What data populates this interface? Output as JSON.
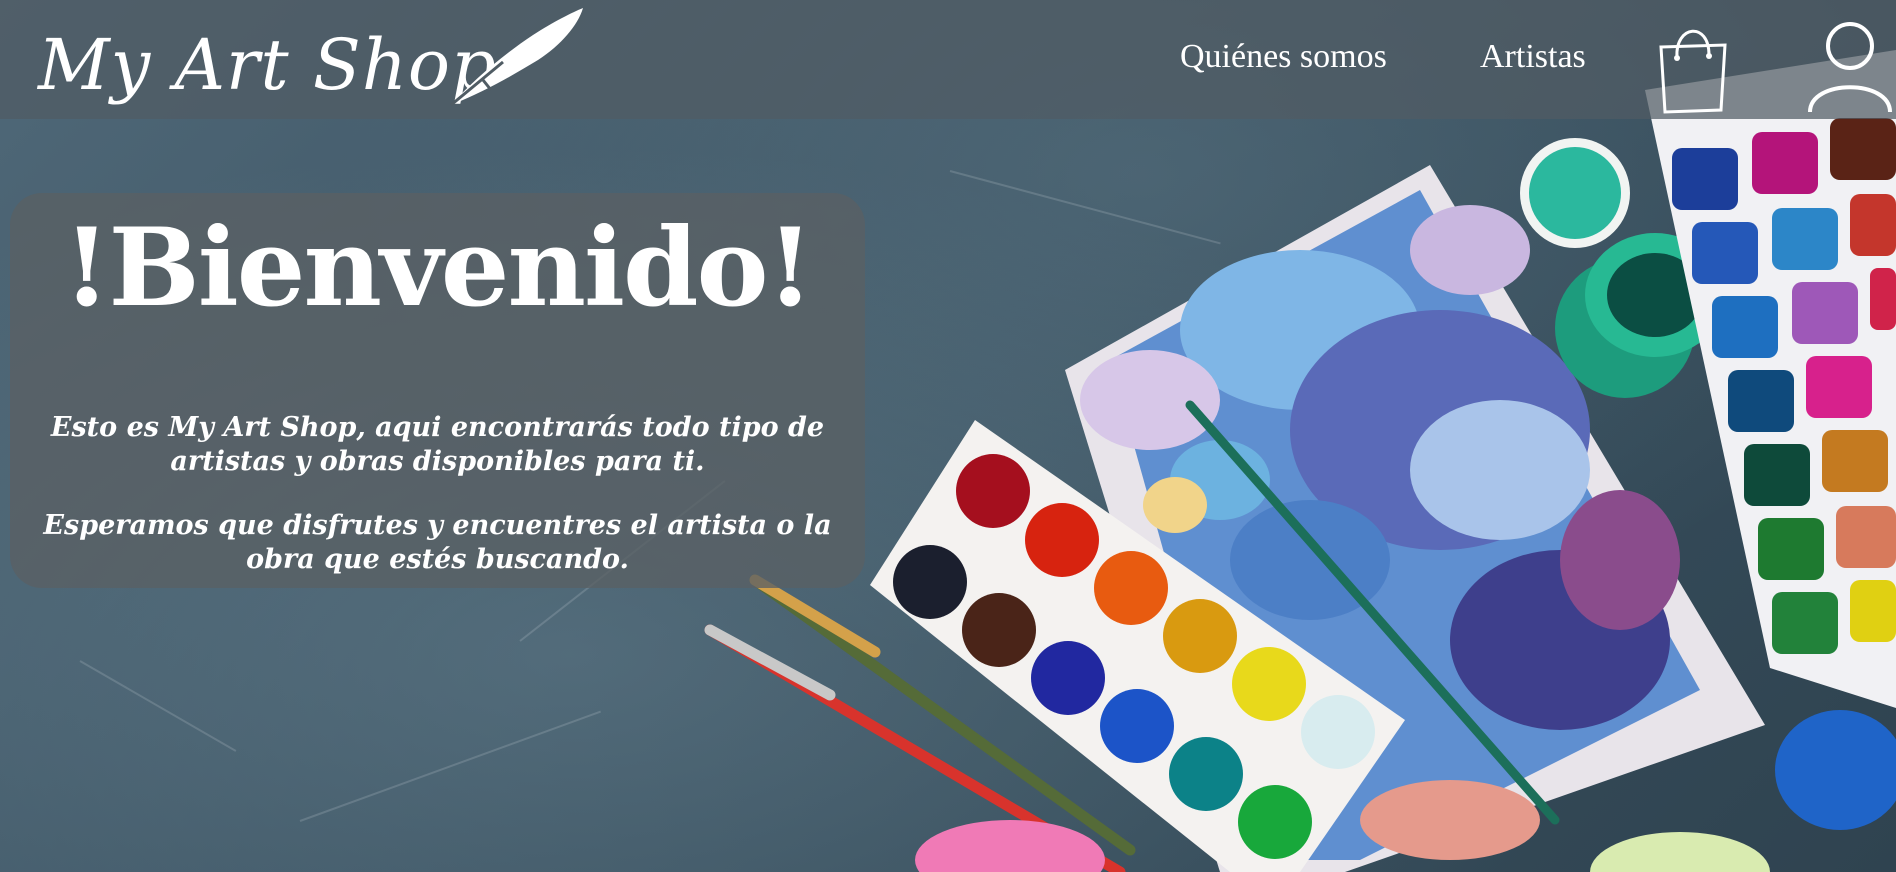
{
  "header": {
    "logo_text": "My Art Shop",
    "nav": [
      {
        "label": "Quiénes somos"
      },
      {
        "label": "Artistas"
      }
    ]
  },
  "welcome": {
    "title": "!Bienvenido!",
    "paragraph1": "Esto es My Art Shop, aqui encontrarás todo tipo de artistas y obras disponibles para ti.",
    "paragraph2": "Esperamos que disfrutes y encuentres el artista o la obra que estés buscando."
  },
  "icons": {
    "logo": "quill-pen-icon",
    "cart": "shopping-bag-icon",
    "account": "user-icon"
  },
  "colors": {
    "header_bg": "#505c64",
    "card_bg": "#5a6064",
    "text": "#ffffff"
  }
}
